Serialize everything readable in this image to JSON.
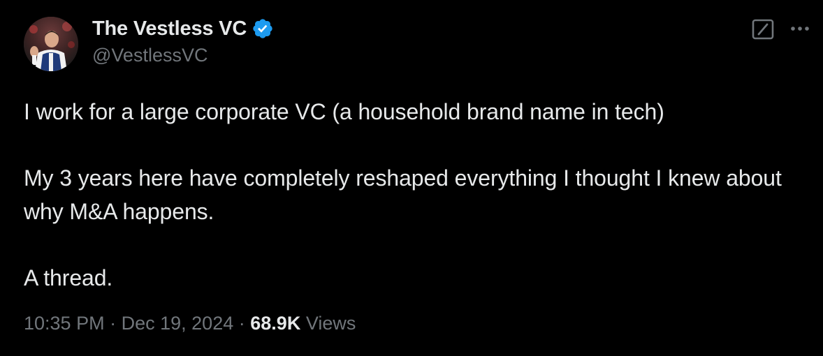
{
  "author": {
    "display_name": "The Vestless VC",
    "handle": "@VestlessVC",
    "avatar_icon": "avatar-photo",
    "verified_icon": "verified-badge-icon",
    "verified_color": "#1d9bf0"
  },
  "toolbar": {
    "grok_icon": "grok-icon",
    "more_icon": "more-options-icon"
  },
  "tweet": {
    "paragraphs": [
      "I work for a large corporate VC (a household brand name in tech)",
      "My 3 years here have completely reshaped everything I thought I knew about why M&A happens.",
      "A thread."
    ]
  },
  "meta": {
    "time": "10:35 PM",
    "separator": "·",
    "date": "Dec 19, 2024",
    "views_count": "68.9K",
    "views_label": "Views"
  },
  "colors": {
    "background": "#000000",
    "primary_text": "#e7e9ea",
    "secondary_text": "#71767b",
    "accent": "#1d9bf0"
  }
}
